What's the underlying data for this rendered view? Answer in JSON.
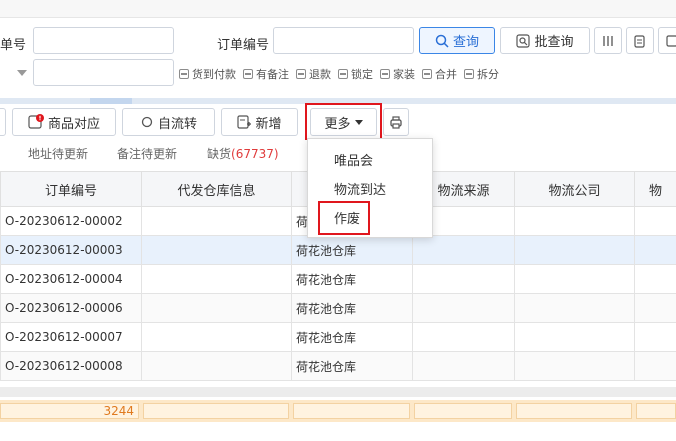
{
  "search": {
    "field1_label": "单号",
    "order_no_label": "订单编号",
    "query_button": "查询",
    "batch_query_button": "批查询",
    "checkboxes": [
      "货到付款",
      "有备注",
      "退款",
      "锁定",
      "家装",
      "合并",
      "拆分"
    ]
  },
  "toolbar": {
    "product_match": "商品对应",
    "auto_flow": "自流转",
    "add_new": "新增",
    "more": "更多"
  },
  "dropdown": {
    "items": [
      "唯品会",
      "物流到达",
      "作废"
    ]
  },
  "filters": {
    "address_pending": "地址待更新",
    "remark_pending": "备注待更新",
    "out_of_stock": "缺货",
    "out_of_stock_count": "(67737)"
  },
  "table": {
    "headers": [
      "订单编号",
      "代发仓库信息",
      "",
      "物流来源",
      "物流公司",
      "物"
    ],
    "rows": [
      {
        "order_no": "O-20230612-00002",
        "warehouse": "荷"
      },
      {
        "order_no": "O-20230612-00003",
        "warehouse": "荷花池仓库"
      },
      {
        "order_no": "O-20230612-00004",
        "warehouse": "荷花池仓库"
      },
      {
        "order_no": "O-20230612-00006",
        "warehouse": "荷花池仓库"
      },
      {
        "order_no": "O-20230612-00007",
        "warehouse": "荷花池仓库"
      },
      {
        "order_no": "O-20230612-00008",
        "warehouse": "荷花池仓库"
      }
    ],
    "footer_total": "3244"
  },
  "colors": {
    "highlight": "#e0161d",
    "primary": "#2a6fd6",
    "selected_row": "#e8f1fc",
    "footer": "#fde8c8",
    "total_text": "#e07a1f"
  }
}
